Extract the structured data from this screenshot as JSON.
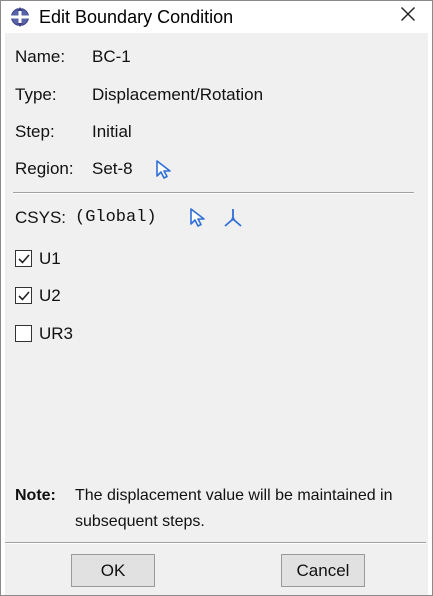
{
  "window": {
    "title": "Edit Boundary Condition",
    "app_icon": "abaqus-logo-icon",
    "close_icon": "close-icon"
  },
  "fields": {
    "name_label": "Name:",
    "name_value": "BC-1",
    "type_label": "Type:",
    "type_value": "Displacement/Rotation",
    "step_label": "Step:",
    "step_value": "Initial",
    "region_label": "Region:",
    "region_value": "Set-8",
    "region_icon": "select-arrow-icon"
  },
  "csys": {
    "label": "CSYS:",
    "value": "(Global)",
    "select_icon": "select-arrow-icon",
    "axis_icon": "csys-axis-icon"
  },
  "dofs": [
    {
      "label": "U1",
      "checked": true
    },
    {
      "label": "U2",
      "checked": true
    },
    {
      "label": "UR3",
      "checked": false
    }
  ],
  "note": {
    "label": "Note:",
    "text": "The displacement value will be maintained in subsequent steps."
  },
  "buttons": {
    "ok": "OK",
    "cancel": "Cancel"
  },
  "colors": {
    "icon_blue": "#2f6fd8",
    "body_bg": "#f0f0f0"
  }
}
